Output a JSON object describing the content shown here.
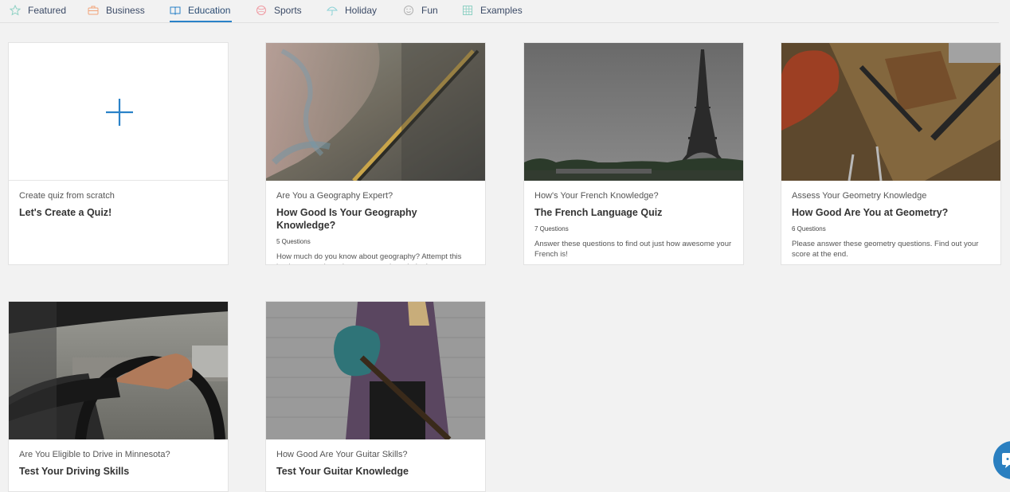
{
  "tabs": [
    {
      "label": "Featured",
      "icon": "star-icon",
      "color": "#8fd1c4"
    },
    {
      "label": "Business",
      "icon": "briefcase-icon",
      "color": "#f2a47a"
    },
    {
      "label": "Education",
      "icon": "book-icon",
      "color": "#2a82c8",
      "active": true
    },
    {
      "label": "Sports",
      "icon": "ball-icon",
      "color": "#f09aa2"
    },
    {
      "label": "Holiday",
      "icon": "umbrella-icon",
      "color": "#8ad2d6"
    },
    {
      "label": "Fun",
      "icon": "smile-icon",
      "color": "#b0b0b0"
    },
    {
      "label": "Examples",
      "icon": "grid-icon",
      "color": "#8fd1c4"
    }
  ],
  "accent": "#2a82c8",
  "cards": [
    {
      "subtitle": "Create quiz from scratch",
      "title": "Let's Create a Quiz!",
      "icon": "plus-icon"
    },
    {
      "subtitle": "Are You a Geography Expert?",
      "title": "How Good Is Your Geography Knowledge?",
      "questions": "5 Questions",
      "description": "How much do you know about geography? Attempt this basic geography quiz to test your knowledge!",
      "image": "world-map-photo"
    },
    {
      "subtitle": "How's Your French Knowledge?",
      "title": "The French Language Quiz",
      "questions": "7 Questions",
      "description": "Answer these questions to find out just how awesome your French is!",
      "image": "eiffel-tower-photo"
    },
    {
      "subtitle": "Assess Your Geometry Knowledge",
      "title": "How Good Are You at Geometry?",
      "questions": "6 Questions",
      "description": "Please answer these geometry questions. Find out your score at the end.",
      "image": "desk-with-ruler-photo"
    },
    {
      "subtitle": "Are You Eligible to Drive in Minnesota?",
      "title": "Test Your Driving Skills",
      "image": "steering-wheel-photo"
    },
    {
      "subtitle": "How Good Are Your Guitar Skills?",
      "title": "Test Your Guitar Knowledge",
      "image": "guitar-player-photo"
    }
  ],
  "chat": {
    "icon": "chat-bubble-icon"
  }
}
